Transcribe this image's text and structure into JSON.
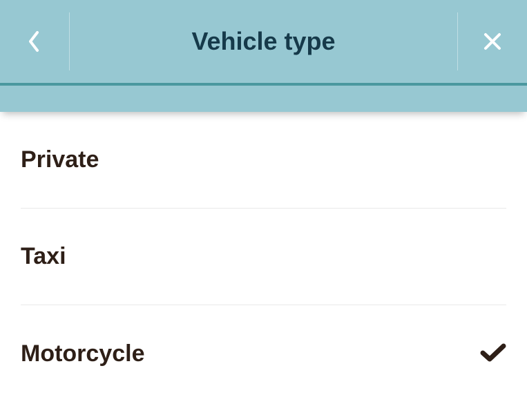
{
  "header": {
    "title": "Vehicle type"
  },
  "list": {
    "items": [
      {
        "label": "Private",
        "selected": false
      },
      {
        "label": "Taxi",
        "selected": false
      },
      {
        "label": "Motorcycle",
        "selected": true
      }
    ]
  }
}
